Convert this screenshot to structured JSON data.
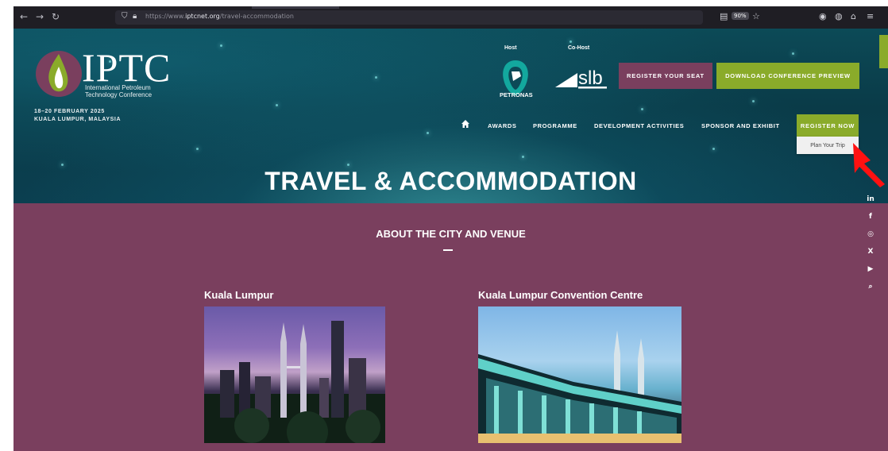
{
  "browser": {
    "back_icon": "arrow-left-icon",
    "forward_icon": "arrow-right-icon",
    "reload_icon": "reload-icon",
    "url_prefix": "https://www.",
    "url_domain": "iptcnet.org",
    "url_path": "/travel-accommodation",
    "zoom": "90%"
  },
  "header": {
    "logo_word": "IPTC",
    "logo_sub_line1": "International Petroleum",
    "logo_sub_line2": "Technology Conference",
    "dates_line1": "18–20 FEBRUARY 2025",
    "dates_line2": "KUALA LUMPUR, MALAYSIA",
    "host_label": "Host",
    "cohost_label": "Co-Host",
    "host_name": "PETRONAS",
    "cohost_name": "slb",
    "register_seat_label": "REGISTER YOUR SEAT",
    "download_label": "DOWNLOAD CONFERENCE PREVIEW"
  },
  "menu": {
    "items": [
      "AWARDS",
      "PROGRAMME",
      "DEVELOPMENT ACTIVITIES",
      "SPONSOR AND EXHIBIT"
    ],
    "register_now_label": "REGISTER NOW",
    "dropdown_item": "Plan Your Trip"
  },
  "hero": {
    "title": "TRAVEL & ACCOMMODATION"
  },
  "social": [
    "in",
    "f",
    "◎",
    "X",
    "▶",
    "⌕"
  ],
  "content": {
    "section_title": "ABOUT THE CITY AND VENUE",
    "cards": [
      {
        "title": "Kuala Lumpur"
      },
      {
        "title": "Kuala Lumpur Convention Centre"
      }
    ]
  },
  "colors": {
    "plum": "#7a3f5e",
    "green": "#8aab2a",
    "hero_teal": "#0c4a57"
  }
}
